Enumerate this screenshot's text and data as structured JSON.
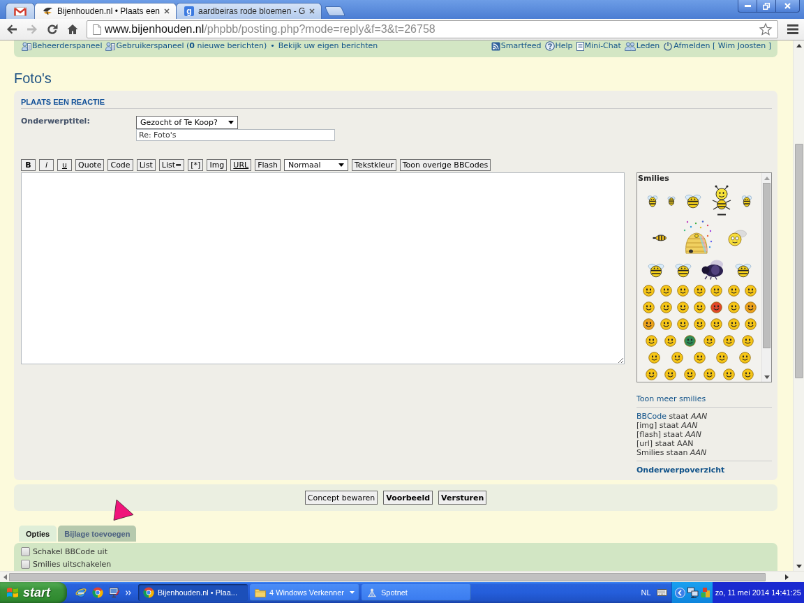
{
  "browser": {
    "tabs": [
      {
        "kind": "mail",
        "selected": false
      },
      {
        "kind": "site",
        "title": "Bijenhouden.nl • Plaats een",
        "selected": true
      },
      {
        "kind": "search",
        "icon_text": "g",
        "title": "aardbeiras rode bloemen - G",
        "selected": false
      }
    ],
    "nav_buttons": [
      {
        "kind": "back",
        "disabled": false
      },
      {
        "kind": "forward",
        "disabled": true
      },
      {
        "kind": "reload",
        "disabled": false
      },
      {
        "kind": "home",
        "disabled": false
      }
    ],
    "address_bar": {
      "host": "www.bijenhouden.nl",
      "path": "/phpbb/posting.php?mode=reply&f=3&t=26758"
    }
  },
  "navbar": {
    "left": [
      {
        "kind": "admin",
        "label": "Beheerderspaneel"
      },
      {
        "kind": "ucp",
        "label": "Gebruikerspaneel (**0** nieuwe berichten)"
      },
      {
        "kind": "separator",
        "label": "•"
      },
      {
        "kind": "link",
        "label": "Bekijk uw eigen berichten"
      }
    ],
    "right": [
      {
        "kind": "feed",
        "label": "Smartfeed"
      },
      {
        "kind": "help",
        "label": "Help"
      },
      {
        "kind": "chat",
        "label": "Mini-Chat"
      },
      {
        "kind": "members",
        "label": "Leden"
      },
      {
        "kind": "logout",
        "label": "Afmelden [ Wim Joosten ]"
      }
    ]
  },
  "page_title": "Foto's",
  "post_form": {
    "heading": "PLAATS EEN REACTIE",
    "subject": {
      "label": "Onderwerptitel:",
      "prefix": "Gezocht of Te Koop?",
      "value": "Re: Foto's"
    },
    "bbcode_buttons": [
      {
        "kind": "bold",
        "label": "B"
      },
      {
        "kind": "italic",
        "label": "i"
      },
      {
        "kind": "underline",
        "label": "u"
      },
      {
        "kind": "plain",
        "label": "Quote"
      },
      {
        "kind": "plain",
        "label": "Code"
      },
      {
        "kind": "plain",
        "label": "List"
      },
      {
        "kind": "plain",
        "label": "List="
      },
      {
        "kind": "plain",
        "label": "[*]"
      },
      {
        "kind": "plain",
        "label": "Img"
      },
      {
        "kind": "underline",
        "label": "URL"
      },
      {
        "kind": "plain",
        "label": "Flash"
      },
      {
        "kind": "select",
        "label": "Normaal"
      },
      {
        "kind": "plain",
        "label": "Tekstkleur"
      },
      {
        "kind": "plain",
        "label": "Toon overige BBCodes"
      }
    ],
    "smilies": {
      "title": "Smilies",
      "rows": [
        {
          "items": [
            {
              "kind": "bee"
            },
            {
              "kind": "small-bee"
            },
            {
              "kind": "winged-bee"
            },
            {
              "kind": "big-bee"
            },
            {
              "kind": "bee"
            }
          ]
        },
        {
          "items": [
            {
              "kind": "side-bee"
            },
            {
              "kind": "hive"
            },
            {
              "kind": "winged-face"
            }
          ]
        },
        {
          "items": [
            {
              "kind": "winged-bee"
            },
            {
              "kind": "winged-bee"
            },
            {
              "kind": "bumblebee"
            },
            {
              "kind": "winged-bee"
            }
          ]
        },
        {
          "items": [
            {
              "kind": "face",
              "color": "#f5c518"
            },
            {
              "kind": "face",
              "color": "#f5c518"
            },
            {
              "kind": "face",
              "color": "#f5c518"
            },
            {
              "kind": "face",
              "color": "#f5c518"
            },
            {
              "kind": "face",
              "color": "#f5c518"
            },
            {
              "kind": "face",
              "color": "#f5c518"
            },
            {
              "kind": "face",
              "color": "#f5c518"
            }
          ]
        },
        {
          "items": [
            {
              "kind": "face",
              "color": "#f5c518"
            },
            {
              "kind": "face",
              "color": "#f5c518"
            },
            {
              "kind": "face",
              "color": "#f5c518"
            },
            {
              "kind": "face",
              "color": "#f5c518"
            },
            {
              "kind": "face",
              "color": "#e2472a"
            },
            {
              "kind": "face",
              "color": "#f5c518"
            },
            {
              "kind": "face",
              "color": "#eca21c"
            }
          ]
        },
        {
          "items": [
            {
              "kind": "face",
              "color": "#eca21c"
            },
            {
              "kind": "face",
              "color": "#f5c518"
            },
            {
              "kind": "face",
              "color": "#f5c518"
            },
            {
              "kind": "face",
              "color": "#f5c518"
            },
            {
              "kind": "face",
              "color": "#f5c518"
            },
            {
              "kind": "face",
              "color": "#f5c518"
            },
            {
              "kind": "face",
              "color": "#f5c518"
            }
          ]
        },
        {
          "items": [
            {
              "kind": "face",
              "color": "#f5c518"
            },
            {
              "kind": "face",
              "color": "#f5c518"
            },
            {
              "kind": "face",
              "color": "#2e8b57"
            },
            {
              "kind": "face",
              "color": "#f5c518"
            },
            {
              "kind": "face",
              "color": "#f5c518"
            },
            {
              "kind": "face",
              "color": "#f5c518"
            }
          ]
        },
        {
          "items": [
            {
              "kind": "face",
              "color": "#f5c518"
            },
            {
              "kind": "face",
              "color": "#f5c518"
            },
            {
              "kind": "face",
              "color": "#f5c518"
            },
            {
              "kind": "face",
              "color": "#f5c518"
            },
            {
              "kind": "face",
              "color": "#f5c518"
            }
          ]
        },
        {
          "items": [
            {
              "kind": "face",
              "color": "#f5c518"
            },
            {
              "kind": "face",
              "color": "#f5c518"
            },
            {
              "kind": "face",
              "color": "#f5c518"
            },
            {
              "kind": "face",
              "color": "#f5c518"
            },
            {
              "kind": "face",
              "color": "#f5c518"
            },
            {
              "kind": "face",
              "color": "#f5c518"
            }
          ]
        }
      ]
    },
    "more_smilies": "Toon meer smilies",
    "status": [
      {
        "link": "BBCode",
        "text": "staat *AAN*"
      },
      {
        "text": "[img] staat *AAN*"
      },
      {
        "text": "[flash] staat *AAN*"
      },
      {
        "text": "[url] staat AAN"
      },
      {
        "text": "Smilies staan *AAN*"
      }
    ],
    "topic_review": "Onderwerpoverzicht"
  },
  "submit_buttons": [
    {
      "kind": "draft",
      "label": "Concept bewaren"
    },
    {
      "kind": "preview",
      "label": "Voorbeeld"
    },
    {
      "kind": "submit",
      "label": "Versturen"
    }
  ],
  "option_tabs": [
    {
      "label": "Opties",
      "selected": true
    },
    {
      "label": "Bijlage toevoegen",
      "selected": false
    }
  ],
  "options": [
    {
      "label": "Schakel BBCode uit",
      "checked": false
    },
    {
      "label": "Smilies uitschakelen",
      "checked": false
    }
  ],
  "taskbar": {
    "start": "start",
    "tasks": [
      {
        "kind": "browser",
        "label": "Bijenhouden.nl • Plaa...",
        "selected": true,
        "grouped": false
      },
      {
        "kind": "folder",
        "label": "4 Windows Verkenner",
        "selected": false,
        "grouped": true
      },
      {
        "kind": "app",
        "label": "Spotnet",
        "selected": false,
        "grouped": false
      }
    ],
    "language": "NL",
    "clock": "zo, 11 mei 2014 14:41:25"
  }
}
